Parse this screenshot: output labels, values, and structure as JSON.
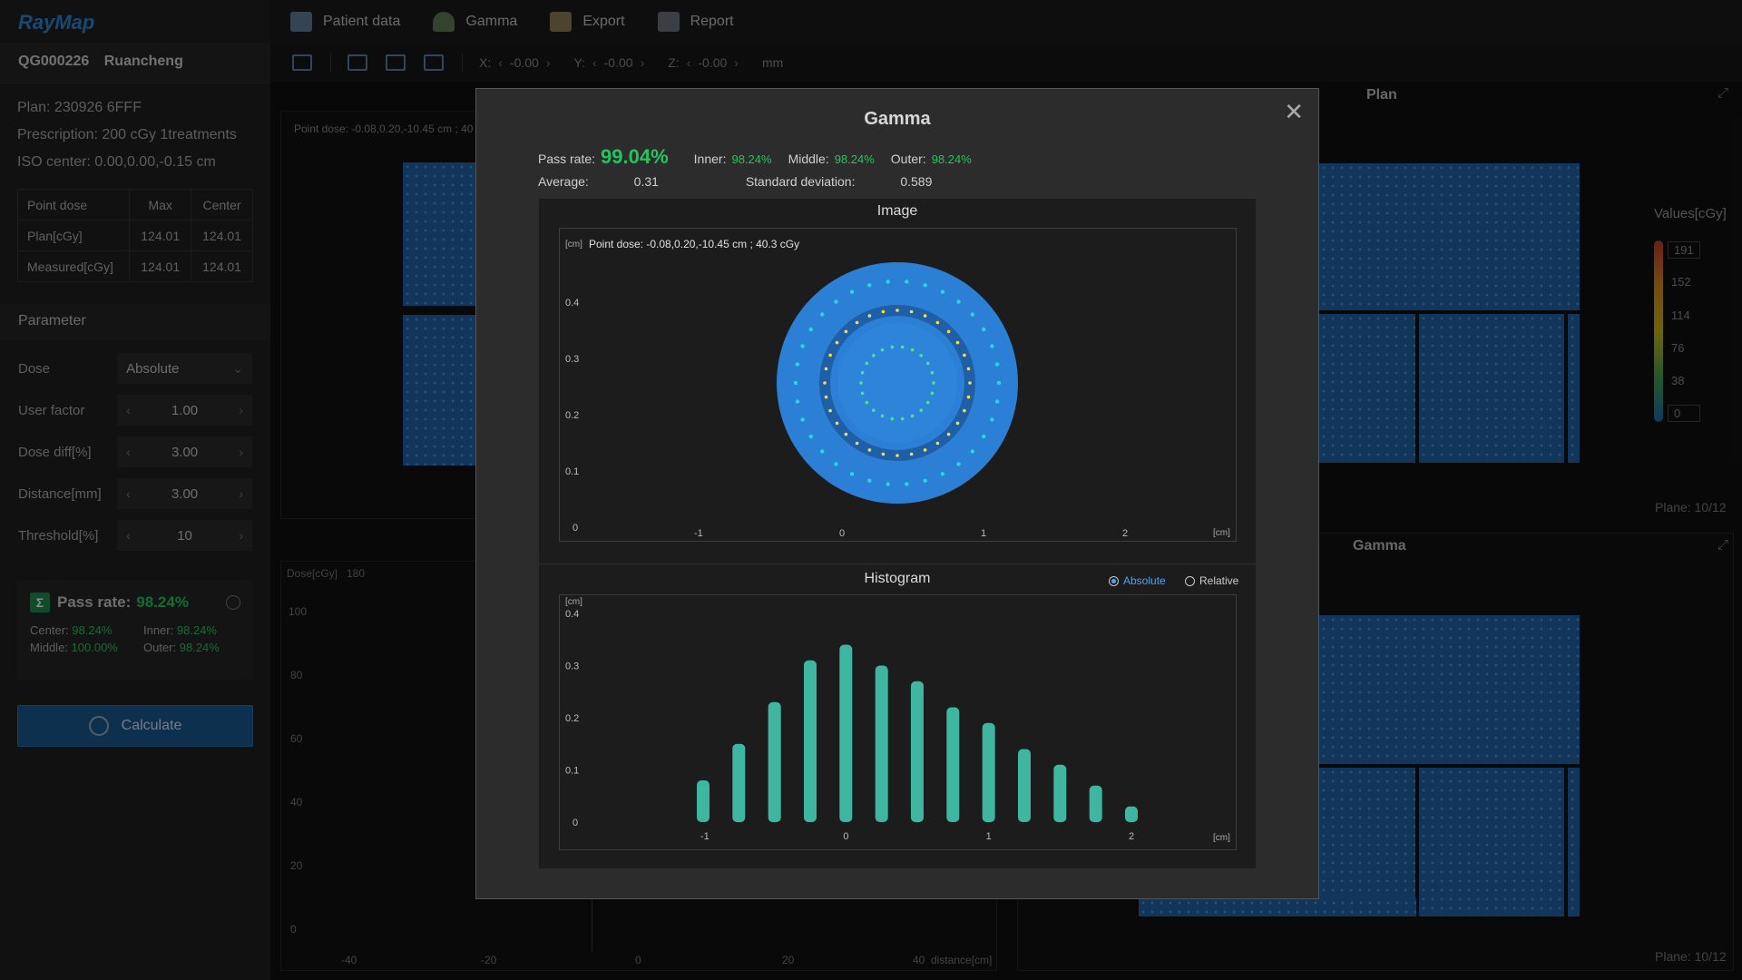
{
  "app": {
    "brand": "RayMap"
  },
  "patient": {
    "id": "QG000226",
    "name": "Ruancheng"
  },
  "plan": {
    "plan_line": "Plan: 230926 6FFF",
    "prescription_line": "Prescription: 200 cGy 1treatments",
    "iso_line": "ISO center: 0.00,0.00,-0.15 cm"
  },
  "point_dose_table": {
    "headers": [
      "Point dose",
      "Max",
      "Center"
    ],
    "rows": [
      {
        "label": "Plan[cGy]",
        "max": "124.01",
        "center": "124.01"
      },
      {
        "label": "Measured[cGy]",
        "max": "124.01",
        "center": "124.01"
      }
    ]
  },
  "parameter": {
    "title": "Parameter",
    "dose_label": "Dose",
    "dose_value": "Absolute",
    "user_factor_label": "User factor",
    "user_factor_value": "1.00",
    "dose_diff_label": "Dose diff[%]",
    "dose_diff_value": "3.00",
    "distance_label": "Distance[mm]",
    "distance_value": "3.00",
    "threshold_label": "Threshold[%]",
    "threshold_value": "10"
  },
  "sidebar_pass": {
    "label": "Pass rate:",
    "value": "98.24%",
    "center_label": "Center:",
    "center_value": "98.24%",
    "inner_label": "Inner:",
    "inner_value": "98.24%",
    "middle_label": "Middle:",
    "middle_value": "100.00%",
    "outer_label": "Outer:",
    "outer_value": "98.24%"
  },
  "calculate_label": "Calculate",
  "nav": {
    "patient_data": "Patient data",
    "gamma": "Gamma",
    "export": "Export",
    "report": "Report"
  },
  "toolbar": {
    "x_label": "X:",
    "x_value": "-0.00",
    "y_label": "Y:",
    "y_value": "-0.00",
    "z_label": "Z:",
    "z_value": "-0.00",
    "unit": "mm"
  },
  "background": {
    "plan_title": "Plan",
    "gamma_title": "Gamma",
    "point_dose_text": "Point dose: -0.08,0.20,-10.45 cm ; 40",
    "plane_plan": "Plane: 10/12",
    "plane_gamma": "Plane: 10/12",
    "values_label": "Values[cGy]",
    "colorbar_values": [
      "191",
      "152",
      "114",
      "76",
      "38",
      "0"
    ],
    "profile_ylabel": "Dose[cGy]",
    "profile_ymax": "180",
    "profile_yticks": [
      "100",
      "80",
      "60",
      "40",
      "20",
      "0"
    ],
    "profile_xticks": [
      "-40",
      "-20",
      "0",
      "20",
      "40"
    ],
    "profile_xlabel": "distance[cm]"
  },
  "modal": {
    "title": "Gamma",
    "pass_rate_label": "Pass rate:",
    "pass_rate_value": "99.04%",
    "inner_label": "Inner:",
    "inner_value": "98.24%",
    "middle_label": "Middle:",
    "middle_value": "98.24%",
    "outer_label": "Outer:",
    "outer_value": "98.24%",
    "average_label": "Average:",
    "average_value": "0.31",
    "std_label": "Standard deviation:",
    "std_value": "0.589",
    "image_title": "Image",
    "image_unit": "[cm]",
    "image_point_dose": "Point dose: -0.08,0.20,-10.45 cm ; 40.3 cGy",
    "image_yticks": [
      "0.4",
      "0.3",
      "0.2",
      "0.1",
      "0"
    ],
    "image_xticks": [
      "-1",
      "0",
      "1",
      "2"
    ],
    "histogram_title": "Histogram",
    "radio_absolute": "Absolute",
    "radio_relative": "Relative",
    "hist_unit": "[cm]"
  },
  "chart_data": {
    "type": "bar",
    "title": "Histogram",
    "x_unit": "[cm]",
    "y_unit": "[cm]",
    "xlim": [
      -1,
      2
    ],
    "ylim": [
      0,
      0.4
    ],
    "x": [
      -1.0,
      -0.75,
      -0.5,
      -0.25,
      0.0,
      0.25,
      0.5,
      0.75,
      1.0,
      1.25,
      1.5,
      1.75,
      2.0
    ],
    "values": [
      0.08,
      0.15,
      0.23,
      0.31,
      0.34,
      0.3,
      0.27,
      0.22,
      0.19,
      0.14,
      0.11,
      0.07,
      0.03
    ],
    "xticks": [
      "-1",
      "0",
      "1",
      "2"
    ],
    "yticks": [
      "0.4",
      "0.3",
      "0.2",
      "0.1",
      "0"
    ],
    "color": "#3fb6a0"
  },
  "colors": {
    "accent": "#2b86d6",
    "pass": "#22c55e",
    "bar": "#3fb6a0"
  }
}
